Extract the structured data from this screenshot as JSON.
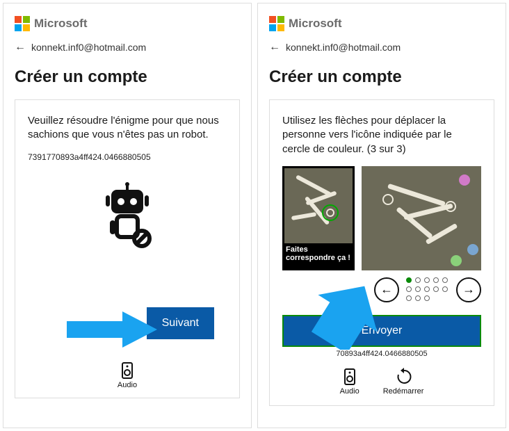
{
  "brand": "Microsoft",
  "email": "konnekt.inf0@hotmail.com",
  "title": "Créer un compte",
  "left": {
    "instruction": "Veuillez résoudre l'énigme pour que nous sachions que vous n'êtes pas un robot.",
    "code": "7391770893a4ff424.0466880505",
    "next_label": "Suivant",
    "audio_label": "Audio"
  },
  "right": {
    "instruction": "Utilisez les flèches pour déplacer la personne vers l'icône indiquée par le cercle de couleur. (3 sur 3)",
    "match_label": "Faites correspondre ça !",
    "submit_label": "Envoyer",
    "code": "70893a4ff424.0466880505",
    "audio_label": "Audio",
    "restart_label": "Redémarrer"
  }
}
